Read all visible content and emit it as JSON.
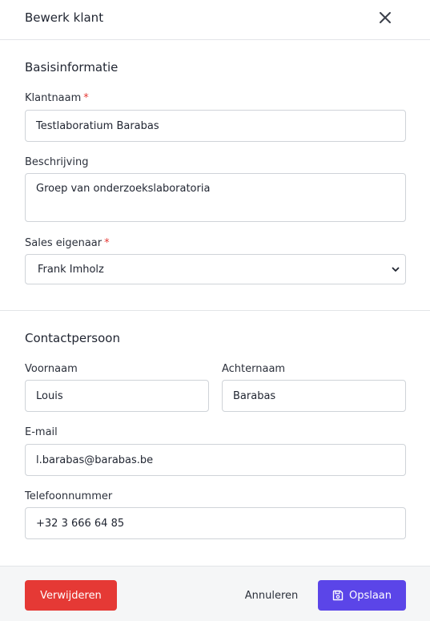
{
  "header": {
    "title": "Bewerk klant",
    "close_icon": "close-icon"
  },
  "basis": {
    "title": "Basisinformatie",
    "klantnaam_label": "Klantnaam",
    "klantnaam_value": "Testlaboratium Barabas",
    "beschrijving_label": "Beschrijving",
    "beschrijving_value": "Groep van onderzoekslaboratoria",
    "sales_label": "Sales eigenaar",
    "sales_value": "Frank Imholz",
    "required_mark": "*"
  },
  "contact": {
    "title": "Contactpersoon",
    "voornaam_label": "Voornaam",
    "voornaam_value": "Louis",
    "achternaam_label": "Achternaam",
    "achternaam_value": "Barabas",
    "email_label": "E-mail",
    "email_value": "l.barabas@barabas.be",
    "telefoon_label": "Telefoonnummer",
    "telefoon_value": "+32 3 666 64 85"
  },
  "footer": {
    "delete_label": "Verwijderen",
    "cancel_label": "Annuleren",
    "save_label": "Opslaan",
    "save_icon": "save-icon"
  },
  "colors": {
    "danger": "#e53935",
    "primary": "#5b45e8",
    "required": "#e53935"
  }
}
